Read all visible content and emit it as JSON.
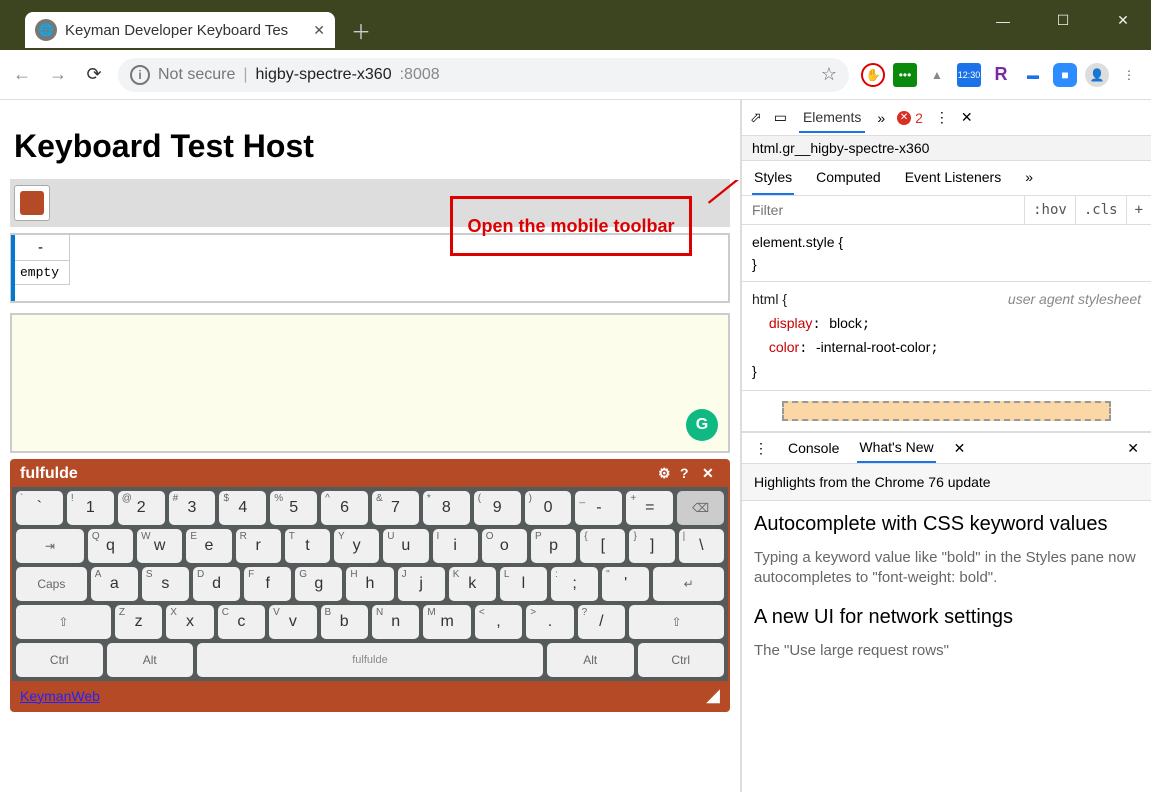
{
  "window": {
    "min": "—",
    "max": "☐",
    "close": "✕"
  },
  "tab": {
    "title": "Keyman Developer Keyboard Tes"
  },
  "nav": {
    "back": "←",
    "fwd": "→",
    "reload": "⟳",
    "ns": "Not secure",
    "host": "higby-spectre-x360",
    "port": ":8008"
  },
  "exticons": {
    "badge": "12:30",
    "r": "R"
  },
  "callout": "Open the mobile toolbar",
  "page": {
    "title": "Keyboard Test Host",
    "dash": "-",
    "empty": "empty",
    "g": "G"
  },
  "kb": {
    "name": "fulfulde",
    "row1": [
      {
        "s": "`",
        "m": "`"
      },
      {
        "s": "!",
        "m": "1"
      },
      {
        "s": "@",
        "m": "2"
      },
      {
        "s": "#",
        "m": "3"
      },
      {
        "s": "$",
        "m": "4"
      },
      {
        "s": "%",
        "m": "5"
      },
      {
        "s": "^",
        "m": "6"
      },
      {
        "s": "&",
        "m": "7"
      },
      {
        "s": "*",
        "m": "8"
      },
      {
        "s": "(",
        "m": "9"
      },
      {
        "s": ")",
        "m": "0"
      },
      {
        "s": "_",
        "m": "-"
      },
      {
        "s": "+",
        "m": "="
      }
    ],
    "row2": [
      {
        "s": "Q",
        "m": "q"
      },
      {
        "s": "W",
        "m": "w"
      },
      {
        "s": "E",
        "m": "e"
      },
      {
        "s": "R",
        "m": "r"
      },
      {
        "s": "T",
        "m": "t"
      },
      {
        "s": "Y",
        "m": "y"
      },
      {
        "s": "U",
        "m": "u"
      },
      {
        "s": "I",
        "m": "i"
      },
      {
        "s": "O",
        "m": "o"
      },
      {
        "s": "P",
        "m": "p"
      },
      {
        "s": "{",
        "m": "["
      },
      {
        "s": "}",
        "m": "]"
      },
      {
        "s": "|",
        "m": "\\"
      }
    ],
    "row3": [
      {
        "s": "A",
        "m": "a"
      },
      {
        "s": "S",
        "m": "s"
      },
      {
        "s": "D",
        "m": "d"
      },
      {
        "s": "F",
        "m": "f"
      },
      {
        "s": "G",
        "m": "g"
      },
      {
        "s": "H",
        "m": "h"
      },
      {
        "s": "J",
        "m": "j"
      },
      {
        "s": "K",
        "m": "k"
      },
      {
        "s": "L",
        "m": "l"
      },
      {
        "s": ":",
        "m": ";"
      },
      {
        "s": "\"",
        "m": "'"
      }
    ],
    "row4": [
      {
        "s": "Z",
        "m": "z"
      },
      {
        "s": "X",
        "m": "x"
      },
      {
        "s": "C",
        "m": "c"
      },
      {
        "s": "V",
        "m": "v"
      },
      {
        "s": "B",
        "m": "b"
      },
      {
        "s": "N",
        "m": "n"
      },
      {
        "s": "M",
        "m": "m"
      },
      {
        "s": "<",
        "m": ","
      },
      {
        "s": ">",
        "m": "."
      },
      {
        "s": "?",
        "m": "/"
      }
    ],
    "mods": {
      "bksp": "⌫",
      "tab": "⇥",
      "caps": "Caps",
      "enter": "↵",
      "shift": "⇧",
      "ctrl": "Ctrl",
      "alt": "Alt",
      "space": "fulfulde"
    },
    "link": "KeymanWeb"
  },
  "devtools": {
    "elTab": "Elements",
    "more": "»",
    "err": "2",
    "crumb": "html.gr__higby-spectre-x360",
    "styleTabs": [
      "Styles",
      "Computed",
      "Event Listeners",
      "»"
    ],
    "filter": {
      "ph": "Filter",
      "hov": ":hov",
      "cls": ".cls",
      "plus": "+"
    },
    "style1a": "element.style {",
    "style1b": "}",
    "style2": {
      "sel": "html {",
      "ua": "user agent stylesheet",
      "k1": "display",
      "v1": "block",
      "k2": "color",
      "v2": "-internal-root-color",
      "end": "}"
    },
    "consoleTabs": [
      "Console",
      "What's New",
      "✕"
    ],
    "hl": "Highlights from the Chrome 76 update",
    "wn1t": "Autocomplete with CSS keyword values",
    "wn1b": "Typing a keyword value like \"bold\" in the Styles pane now autocompletes to \"font-weight: bold\".",
    "wn2t": "A new UI for network settings",
    "wn2b": "The \"Use large request rows\""
  }
}
